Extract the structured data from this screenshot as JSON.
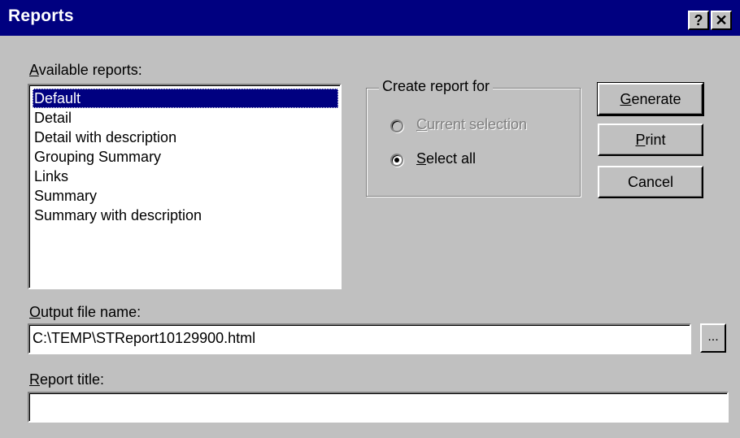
{
  "window": {
    "title": "Reports",
    "help_button": "?",
    "close_button": "✕"
  },
  "available_reports": {
    "label_accel": "A",
    "label_rest": "vailable reports:",
    "items": [
      {
        "label": "Default",
        "selected": true
      },
      {
        "label": "Detail",
        "selected": false
      },
      {
        "label": "Detail with description",
        "selected": false
      },
      {
        "label": "Grouping Summary",
        "selected": false
      },
      {
        "label": "Links",
        "selected": false
      },
      {
        "label": "Summary",
        "selected": false
      },
      {
        "label": "Summary with description",
        "selected": false
      }
    ]
  },
  "create_report_for": {
    "legend": "Create report for",
    "options": [
      {
        "accel": "C",
        "rest": "urrent selection",
        "checked": false,
        "enabled": false
      },
      {
        "accel": "S",
        "rest": "elect all",
        "checked": true,
        "enabled": true
      }
    ]
  },
  "buttons": {
    "generate_accel": "G",
    "generate_rest": "enerate",
    "print_accel": "P",
    "print_rest": "rint",
    "cancel": "Cancel"
  },
  "output_file": {
    "label_accel": "O",
    "label_rest": "utput file name:",
    "value": "C:\\TEMP\\STReport10129900.html",
    "browse_label": "..."
  },
  "report_title": {
    "label_accel": "R",
    "label_rest": "eport title:",
    "value": ""
  },
  "colors": {
    "titlebar": "#000080",
    "face": "#c0c0c0",
    "selection": "#000080"
  }
}
